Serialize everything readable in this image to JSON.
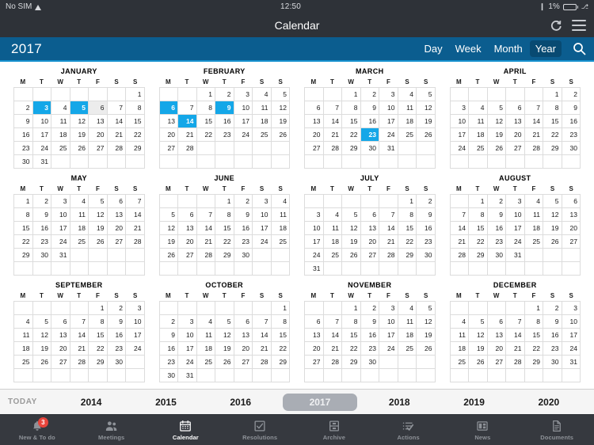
{
  "status_bar": {
    "carrier": "No SIM",
    "wifi_icon": "wifi-icon",
    "time": "12:50",
    "bluetooth_icon": "bluetooth-icon",
    "battery_percent": "1%",
    "battery_icon": "battery-icon",
    "charging_icon": "charging-bolt-icon"
  },
  "title_bar": {
    "title": "Calendar",
    "refresh_icon": "refresh-icon",
    "menu_icon": "hamburger-menu-icon"
  },
  "nav_bar": {
    "year": "2017",
    "views": [
      {
        "label": "Day",
        "active": false
      },
      {
        "label": "Week",
        "active": false
      },
      {
        "label": "Month",
        "active": false
      },
      {
        "label": "Year",
        "active": true
      }
    ],
    "search_icon": "search-icon",
    "background_color": "#0b5d8f",
    "accent_color": "#1691cf"
  },
  "calendar": {
    "weekday_headers": [
      "M",
      "T",
      "W",
      "T",
      "F",
      "S",
      "S"
    ],
    "highlight_color": "#14a7e8",
    "shade_color": "#ececec",
    "months": [
      {
        "name": "JANUARY",
        "first_weekday": 6,
        "days": 31,
        "selected": [
          3,
          5
        ],
        "shaded": [
          6
        ]
      },
      {
        "name": "FEBRUARY",
        "first_weekday": 2,
        "days": 28,
        "selected": [
          6,
          9,
          14
        ],
        "shaded": []
      },
      {
        "name": "MARCH",
        "first_weekday": 2,
        "days": 31,
        "selected": [
          23
        ],
        "shaded": []
      },
      {
        "name": "APRIL",
        "first_weekday": 5,
        "days": 30,
        "selected": [],
        "shaded": []
      },
      {
        "name": "MAY",
        "first_weekday": 0,
        "days": 31,
        "selected": [],
        "shaded": []
      },
      {
        "name": "JUNE",
        "first_weekday": 3,
        "days": 30,
        "selected": [],
        "shaded": []
      },
      {
        "name": "JULY",
        "first_weekday": 5,
        "days": 31,
        "selected": [],
        "shaded": []
      },
      {
        "name": "AUGUST",
        "first_weekday": 1,
        "days": 31,
        "selected": [],
        "shaded": []
      },
      {
        "name": "SEPTEMBER",
        "first_weekday": 4,
        "days": 30,
        "selected": [],
        "shaded": []
      },
      {
        "name": "OCTOBER",
        "first_weekday": 6,
        "days": 31,
        "selected": [],
        "shaded": []
      },
      {
        "name": "NOVEMBER",
        "first_weekday": 2,
        "days": 30,
        "selected": [],
        "shaded": []
      },
      {
        "name": "DECEMBER",
        "first_weekday": 4,
        "days": 31,
        "selected": [],
        "shaded": []
      }
    ]
  },
  "year_bar": {
    "today_label": "TODAY",
    "years": [
      {
        "label": "2014",
        "active": false
      },
      {
        "label": "2015",
        "active": false
      },
      {
        "label": "2016",
        "active": false
      },
      {
        "label": "2017",
        "active": true
      },
      {
        "label": "2018",
        "active": false
      },
      {
        "label": "2019",
        "active": false
      },
      {
        "label": "2020",
        "active": false
      }
    ]
  },
  "tab_bar": {
    "tabs": [
      {
        "label": "New & To do",
        "icon": "bell-icon",
        "active": false,
        "badge": "3"
      },
      {
        "label": "Meetings",
        "icon": "people-icon",
        "active": false,
        "badge": null
      },
      {
        "label": "Calendar",
        "icon": "calendar-icon",
        "active": true,
        "badge": null
      },
      {
        "label": "Resolutions",
        "icon": "checkbox-icon",
        "active": false,
        "badge": null
      },
      {
        "label": "Archive",
        "icon": "archive-icon",
        "active": false,
        "badge": null
      },
      {
        "label": "Actions",
        "icon": "checklist-icon",
        "active": false,
        "badge": null
      },
      {
        "label": "News",
        "icon": "news-icon",
        "active": false,
        "badge": null
      },
      {
        "label": "Documents",
        "icon": "document-icon",
        "active": false,
        "badge": null
      }
    ]
  }
}
